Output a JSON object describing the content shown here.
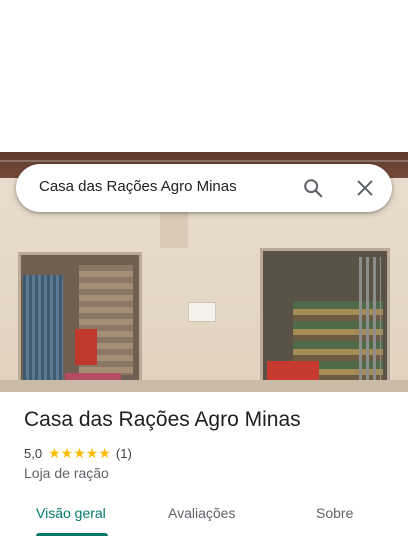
{
  "search": {
    "query": "Casa das Rações Agro Minas",
    "search_icon": "search-icon",
    "close_icon": "close-icon"
  },
  "place": {
    "name": "Casa das Rações Agro Minas",
    "rating": "5,0",
    "stars_filled": 5,
    "review_count": "(1)",
    "category": "Loja de ração"
  },
  "tabs": [
    {
      "label": "Visão geral",
      "active": true
    },
    {
      "label": "Avaliações",
      "active": false
    },
    {
      "label": "Sobre",
      "active": false
    }
  ],
  "colors": {
    "accent": "#00796b",
    "star": "#fbbc04",
    "text_primary": "#202124",
    "text_secondary": "#5f6368"
  }
}
